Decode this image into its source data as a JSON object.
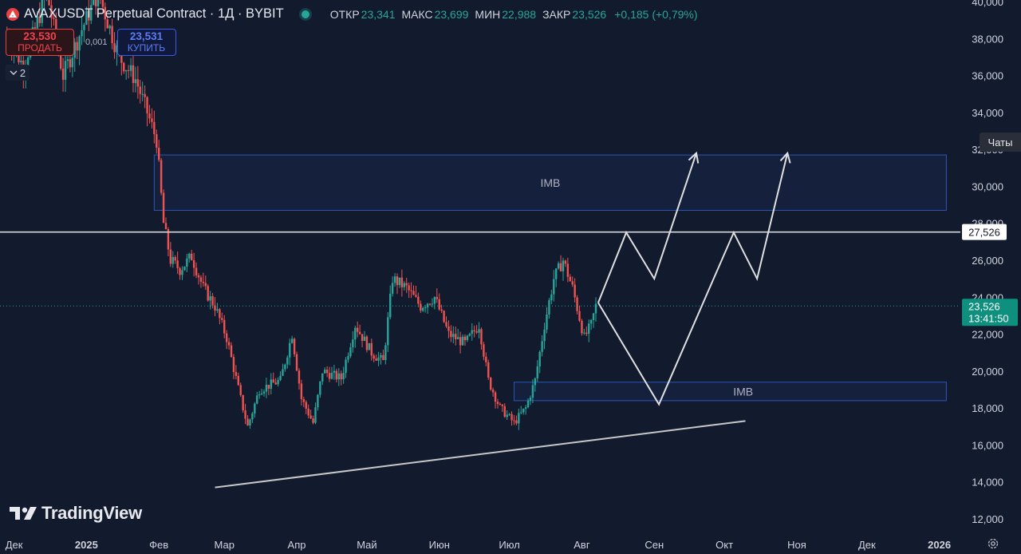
{
  "header": {
    "symbol": "AVAXUSDT Perpetual Contract · 1Д · BYBIT",
    "ohlc": [
      {
        "k": "ОТКР",
        "v": "23,341"
      },
      {
        "k": "МАКС",
        "v": "23,699"
      },
      {
        "k": "МИН",
        "v": "22,988"
      },
      {
        "k": "ЗАКР",
        "v": "23,526"
      },
      {
        "k": "",
        "v": "+0,185 (+0,79%)"
      }
    ]
  },
  "trade": {
    "sell_price": "23,530",
    "sell_label": "ПРОДАТЬ",
    "spread": "0,001",
    "buy_price": "23,531",
    "buy_label": "КУПИТЬ"
  },
  "collapse": {
    "count": "2"
  },
  "logo": {
    "text": "TradingView"
  },
  "chats_label": "Чаты",
  "colors": {
    "bg": "#121a2e",
    "up": "#26a69a",
    "down": "#ef5350",
    "zone": "#1e3a70",
    "line": "#c8c8c8"
  },
  "chart_data": {
    "type": "candlestick",
    "y_axis": {
      "min": 12000,
      "max": 40000,
      "ticks": [
        "12,000",
        "14,000",
        "16,000",
        "18,000",
        "20,000",
        "22,000",
        "24,000",
        "26,000",
        "28,000",
        "30,000",
        "32,000",
        "34,000",
        "36,000",
        "38,000",
        "40,000"
      ]
    },
    "x_ticks": [
      "Дек",
      "2025",
      "Фев",
      "Мар",
      "Апр",
      "Май",
      "Июн",
      "Июл",
      "Авг",
      "Сен",
      "Окт",
      "Ноя",
      "Дек",
      "2026"
    ],
    "x_range": [
      "2024-11-25",
      "2026-01-10"
    ],
    "price_level": {
      "value": 27526,
      "label": "27,526"
    },
    "last_price": {
      "value": 23526,
      "label": "23,526",
      "countdown": "13:41:50"
    },
    "zones": [
      {
        "label": "IMB",
        "top": 31700,
        "bottom": 28700,
        "from": "2025-01-30",
        "to": "2026-01-04"
      },
      {
        "label": "IMB",
        "top": 19400,
        "bottom": 18400,
        "from": "2025-07-03",
        "to": "2026-01-04"
      }
    ],
    "trendline": {
      "from": [
        "2025-02-25",
        13700
      ],
      "to": [
        "2025-10-10",
        17300
      ]
    },
    "projections": [
      [
        [
          "2025-08-08",
          23700
        ],
        [
          "2025-09-03",
          18200
        ],
        [
          "2025-10-05",
          27500
        ],
        [
          "2025-10-15",
          25000
        ],
        [
          "2025-10-28",
          31800
        ]
      ],
      [
        [
          "2025-08-08",
          23700
        ],
        [
          "2025-08-20",
          27500
        ],
        [
          "2025-09-01",
          25000
        ],
        [
          "2025-09-19",
          31800
        ]
      ]
    ],
    "anchors": [
      [
        "2024-11-28",
        38200
      ],
      [
        "2024-12-05",
        36500
      ],
      [
        "2024-12-15",
        40500
      ],
      [
        "2024-12-22",
        36000
      ],
      [
        "2024-12-30",
        38500
      ],
      [
        "2025-01-06",
        40500
      ],
      [
        "2025-01-15",
        37000
      ],
      [
        "2025-01-22",
        35800
      ],
      [
        "2025-01-27",
        34000
      ],
      [
        "2025-01-31",
        32500
      ],
      [
        "2025-02-03",
        28000
      ],
      [
        "2025-02-06",
        26000
      ],
      [
        "2025-02-10",
        25500
      ],
      [
        "2025-02-15",
        26200
      ],
      [
        "2025-02-20",
        24500
      ],
      [
        "2025-02-25",
        23500
      ],
      [
        "2025-03-02",
        21800
      ],
      [
        "2025-03-08",
        18500
      ],
      [
        "2025-03-11",
        17000
      ],
      [
        "2025-03-16",
        19000
      ],
      [
        "2025-03-25",
        19500
      ],
      [
        "2025-03-30",
        22000
      ],
      [
        "2025-04-03",
        18500
      ],
      [
        "2025-04-08",
        17200
      ],
      [
        "2025-04-12",
        20000
      ],
      [
        "2025-04-20",
        19600
      ],
      [
        "2025-04-26",
        22500
      ],
      [
        "2025-05-03",
        21000
      ],
      [
        "2025-05-08",
        20500
      ],
      [
        "2025-05-12",
        25000
      ],
      [
        "2025-05-18",
        24500
      ],
      [
        "2025-05-24",
        23500
      ],
      [
        "2025-05-30",
        24000
      ],
      [
        "2025-06-05",
        22000
      ],
      [
        "2025-06-12",
        21500
      ],
      [
        "2025-06-18",
        22500
      ],
      [
        "2025-06-22",
        19500
      ],
      [
        "2025-06-27",
        18000
      ],
      [
        "2025-07-03",
        17200
      ],
      [
        "2025-07-08",
        18000
      ],
      [
        "2025-07-12",
        19500
      ],
      [
        "2025-07-16",
        22500
      ],
      [
        "2025-07-20",
        25000
      ],
      [
        "2025-07-24",
        26000
      ],
      [
        "2025-07-28",
        24500
      ],
      [
        "2025-08-02",
        21800
      ],
      [
        "2025-08-05",
        22500
      ],
      [
        "2025-08-07",
        23526
      ]
    ]
  }
}
